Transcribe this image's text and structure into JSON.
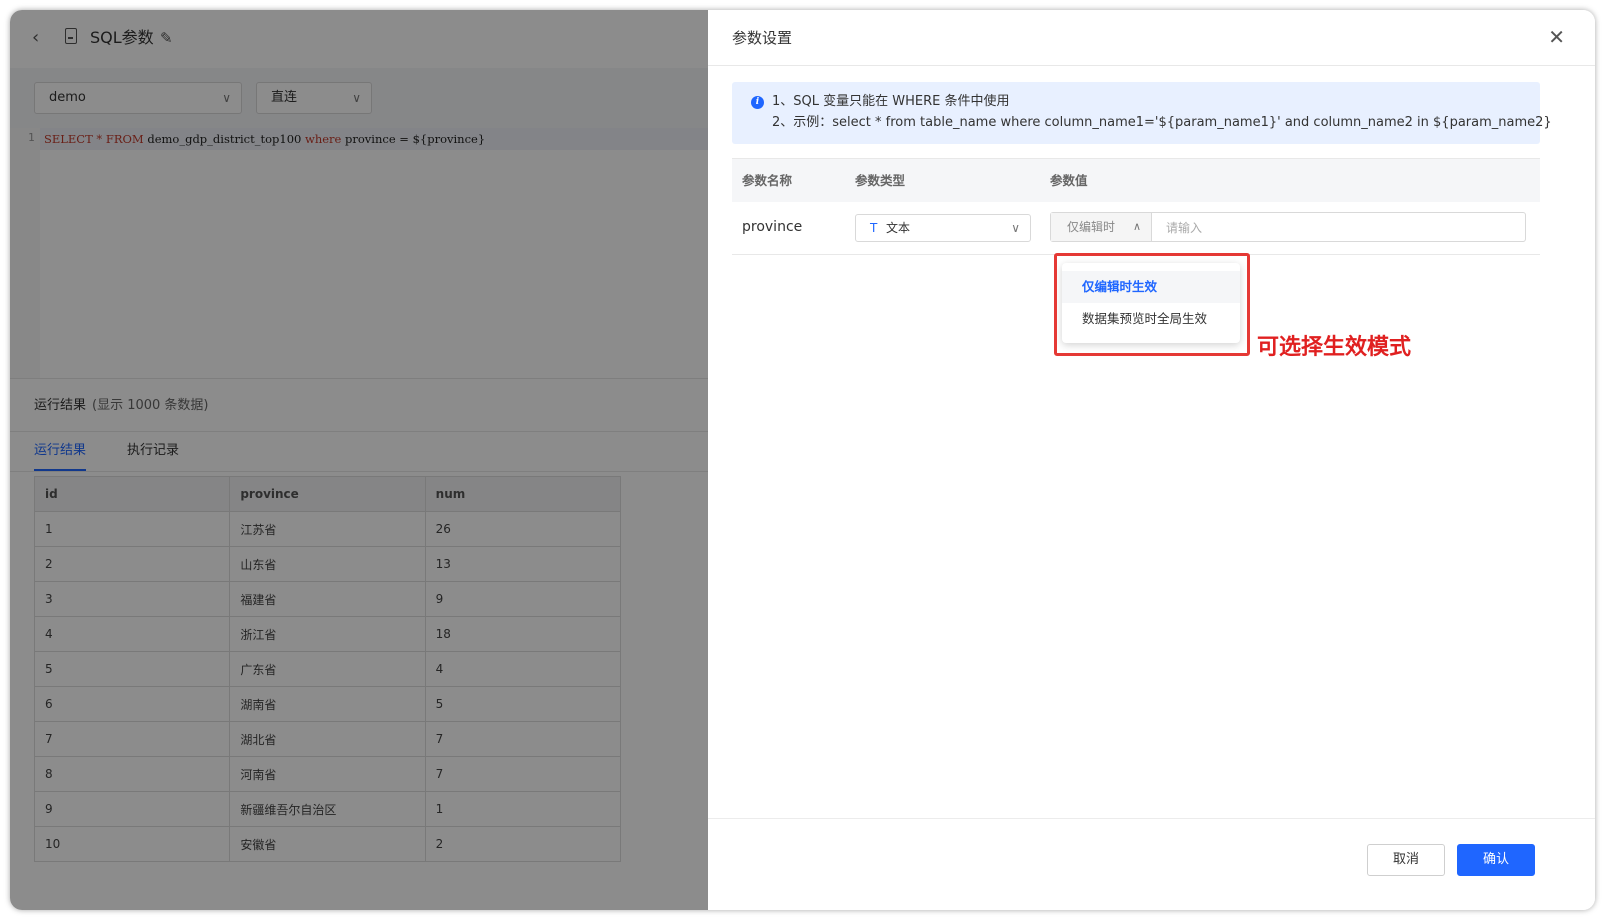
{
  "header": {
    "title": "SQL参数"
  },
  "toolbar": {
    "dataset_select": "demo",
    "connection_select": "直连"
  },
  "editor": {
    "line_number": "1",
    "code": {
      "select": "SELECT",
      "star": " * ",
      "from": "FROM",
      "table": " demo_gdp_district_top100 ",
      "where": "where",
      "rest": " province = ${province}"
    }
  },
  "results": {
    "title": "运行结果",
    "subtitle": "(显示 1000 条数据)",
    "tabs": [
      "运行结果",
      "执行记录"
    ],
    "columns": [
      "id",
      "province",
      "num"
    ],
    "rows": [
      [
        "1",
        "江苏省",
        "26"
      ],
      [
        "2",
        "山东省",
        "13"
      ],
      [
        "3",
        "福建省",
        "9"
      ],
      [
        "4",
        "浙江省",
        "18"
      ],
      [
        "5",
        "广东省",
        "4"
      ],
      [
        "6",
        "湖南省",
        "5"
      ],
      [
        "7",
        "湖北省",
        "7"
      ],
      [
        "8",
        "河南省",
        "7"
      ],
      [
        "9",
        "新疆维吾尔自治区",
        "1"
      ],
      [
        "10",
        "安徽省",
        "2"
      ]
    ]
  },
  "drawer": {
    "title": "参数设置",
    "alert": {
      "line1": "1、SQL 变量只能在 WHERE 条件中使用",
      "line2": "2、示例：select * from table_name where column_name1='${param_name1}' and column_name2 in ${param_name2}"
    },
    "table_headers": {
      "name": "参数名称",
      "type": "参数类型",
      "value": "参数值"
    },
    "param": {
      "name": "province",
      "type_icon": "T",
      "type": "文本",
      "mode": "仅编辑时",
      "value_placeholder": "请输入"
    },
    "mode_options": [
      "仅编辑时生效",
      "数据集预览时全局生效"
    ],
    "annotation": "可选择生效模式",
    "footer": {
      "cancel": "取消",
      "confirm": "确认"
    }
  },
  "colors": {
    "accent": "#1f66ff",
    "annotation": "#e02020"
  }
}
